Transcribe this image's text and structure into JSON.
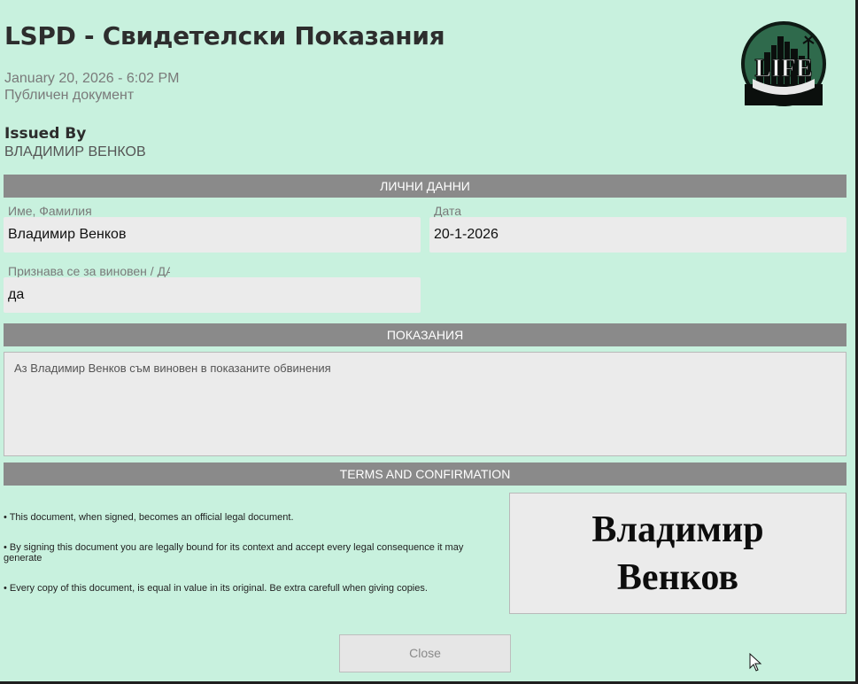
{
  "header": {
    "title": "LSPD - Свидетелски Показания",
    "date": "January 20, 2026 - 6:02 PM",
    "status": "Публичен документ",
    "logo_text": "LIFE"
  },
  "issued": {
    "label": "Issued By",
    "name": "ВЛАДИМИР ВЕНКОВ"
  },
  "personal": {
    "section_title": "ЛИЧНИ ДАННИ",
    "name_label": "Име, Фамилия",
    "name_value": "Владимир Венков",
    "date_label": "Дата",
    "date_value": "20-1-2026",
    "guilty_label": "Признава се за виновен / ДА",
    "guilty_value": "да"
  },
  "testimony": {
    "section_title": "ПОКАЗАНИЯ",
    "text": "Аз Владимир Венков съм виновен в показаните обвинения"
  },
  "terms": {
    "section_title": "TERMS AND CONFIRMATION",
    "items": [
      "• This document, when signed, becomes an official legal document.",
      "• By signing this document you are legally bound for its context and accept every legal consequence it may generate",
      "• Every copy of this document, is equal in value in its original. Be extra carefull when giving copies."
    ],
    "signature": "Владимир Венков"
  },
  "footer": {
    "close_label": "Close"
  },
  "colors": {
    "background": "#c8f1de",
    "section_bar": "#8a8a8a",
    "field_bg": "#ebebeb"
  }
}
